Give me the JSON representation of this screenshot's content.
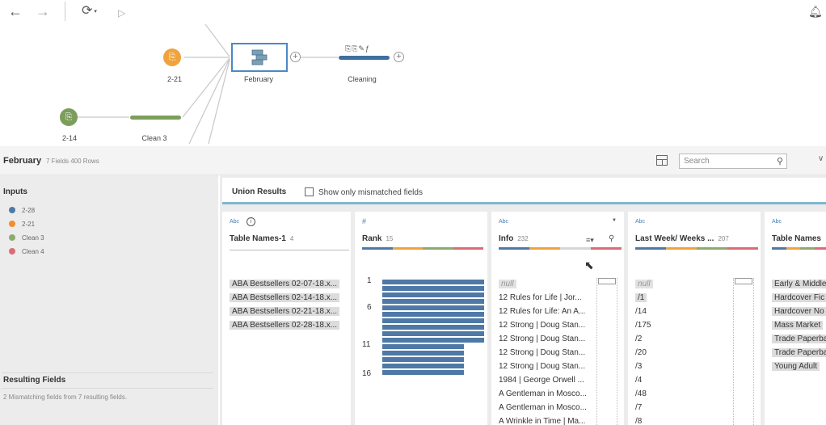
{
  "toolbar": {
    "back_icon": "arrow-left-icon",
    "forward_icon": "arrow-right-icon",
    "refresh_icon": "refresh-icon",
    "run_icon": "play-icon",
    "bell_icon": "bell-icon"
  },
  "flow": {
    "nodes": [
      {
        "label": "2-21",
        "color": "#f0a33c"
      },
      {
        "label": "2-14",
        "color": "#7c9e5c"
      },
      {
        "label": "Clean 3",
        "color": "#7c9e5c"
      },
      {
        "label": "February",
        "color": "#4b88c7"
      },
      {
        "label": "Cleaning",
        "color": "#3f6f9e"
      }
    ]
  },
  "header": {
    "title": "February",
    "meta": "7 Fields  400 Rows",
    "search_placeholder": "Search"
  },
  "inputs": {
    "heading": "Inputs",
    "items": [
      {
        "label": "2-28",
        "color": "#4e79a7"
      },
      {
        "label": "2-21",
        "color": "#f28e2b"
      },
      {
        "label": "Clean 3",
        "color": "#8cab6b"
      },
      {
        "label": "Clean 4",
        "color": "#d96b7a"
      }
    ]
  },
  "resulting": {
    "heading": "Resulting Fields",
    "note": "2 Mismatching fields from 7 resulting fields."
  },
  "union": {
    "tab_title": "Union Results",
    "checkbox_label": "Show only mismatched fields"
  },
  "columns": {
    "table_names_1": {
      "type": "Abc",
      "name": "Table Names-1",
      "count": "4",
      "values": [
        "ABA Bestsellers 02-07-18.x...",
        "ABA Bestsellers 02-14-18.x...",
        "ABA Bestsellers 02-21-18.x...",
        "ABA Bestsellers 02-28-18.x..."
      ]
    },
    "rank": {
      "type": "#",
      "name": "Rank",
      "count": "15",
      "tick_labels": [
        "1",
        "6",
        "11",
        "16"
      ],
      "bars": [
        1,
        1,
        1,
        1,
        1,
        1,
        1,
        1,
        1,
        1,
        0.8,
        0.8,
        0.8,
        0.8,
        0.8
      ]
    },
    "info": {
      "type": "Abc",
      "name": "Info",
      "count": "232",
      "values": [
        "null",
        "12 Rules for Life | Jor...",
        "12 Rules for Life: An A...",
        "12 Strong | Doug Stan...",
        "12 Strong | Doug Stan...",
        "12 Strong | Doug Stan...",
        "12 Strong | Doug Stan...",
        "1984 | George Orwell ...",
        "A Gentleman in Mosco...",
        "A Gentleman in Mosco...",
        "A Wrinkle in Time | Ma..."
      ]
    },
    "last_week": {
      "type": "Abc",
      "name": "Last Week/ Weeks ...",
      "count": "207",
      "values": [
        "null",
        "/1",
        "/14",
        "/175",
        "/2",
        "/20",
        "/3",
        "/4",
        "/48",
        "/7",
        "/8"
      ]
    },
    "table_names": {
      "type": "Abc",
      "name": "Table Names",
      "values": [
        "Early & Middle",
        "Hardcover Fic",
        "Hardcover No",
        "Mass Market",
        "Trade Paperba",
        "Trade Paperba",
        "Young Adult"
      ]
    }
  },
  "source_colors": [
    "#4e79a7",
    "#f0a33c",
    "#8cab6b",
    "#d96b7a"
  ]
}
